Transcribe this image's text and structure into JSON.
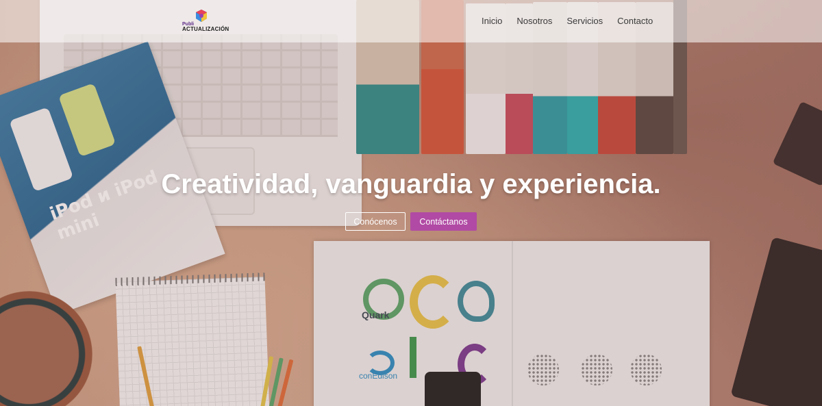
{
  "header": {
    "logo": {
      "small_text": "Publi",
      "brand_text": "ACTUALIZACIÓN",
      "icon": "colorful-cube-logo"
    },
    "nav": [
      {
        "label": "Inicio"
      },
      {
        "label": "Nosotros"
      },
      {
        "label": "Servicios"
      },
      {
        "label": "Contacto"
      }
    ]
  },
  "hero": {
    "headline": "Creatividad, vanguardia y experiencia.",
    "buttons": {
      "primary_outline": "Conócenos",
      "secondary_filled": "Contáctanos"
    },
    "background_image_labels": {
      "flyer_text": "iPod и iPod mini",
      "logo_quark": "Quark",
      "logo_conedison": "conEdison"
    }
  },
  "colors": {
    "accent": "#b14aa4",
    "headline": "#ffffff",
    "nav_text": "#3a3a3a"
  }
}
